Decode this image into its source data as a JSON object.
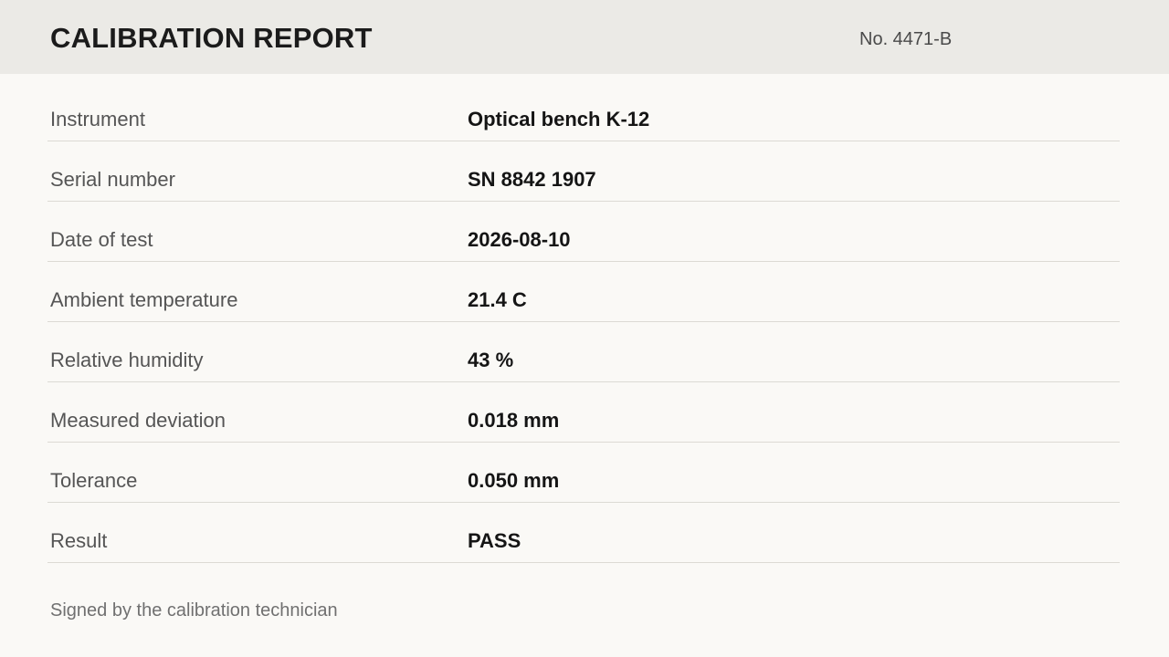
{
  "report": {
    "title": "CALIBRATION REPORT",
    "number": "No. 4471-B"
  },
  "fields": [
    {
      "label": "Instrument",
      "value": "Optical bench K-12"
    },
    {
      "label": "Serial number",
      "value": "SN 8842 1907"
    },
    {
      "label": "Date of test",
      "value": "2026-08-10"
    },
    {
      "label": "Ambient temperature",
      "value": "21.4 C"
    },
    {
      "label": "Relative humidity",
      "value": "43 %"
    },
    {
      "label": "Measured deviation",
      "value": "0.018 mm"
    },
    {
      "label": "Tolerance",
      "value": "0.050 mm"
    },
    {
      "label": "Result",
      "value": "PASS"
    }
  ],
  "footer": {
    "signature": "Signed by the calibration technician"
  }
}
